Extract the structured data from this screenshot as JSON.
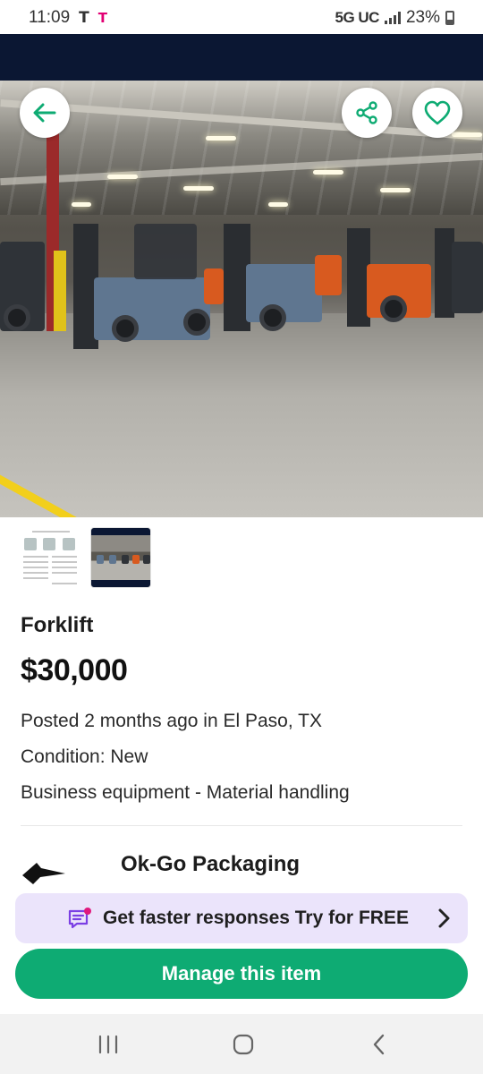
{
  "status_bar": {
    "time": "11:09",
    "carrier_icon_1": "T",
    "carrier_icon_2": "T",
    "network": "5G UC",
    "battery": "23%"
  },
  "header": {
    "back_icon": "arrow-left-icon",
    "share_icon": "share-icon",
    "favorite_icon": "heart-icon",
    "accent_color": "#0eab73"
  },
  "listing": {
    "title": "Forklift",
    "price": "$30,000",
    "posted": "Posted 2 months ago in El Paso, TX",
    "condition": "Condition: New",
    "category": "Business equipment - Material handling"
  },
  "seller": {
    "name": "Ok-Go Packaging"
  },
  "promo": {
    "text": "Get faster responses Try for FREE",
    "background": "#ebe4fb",
    "icon_color": "#7b3fe4",
    "dot_color": "#e0197d"
  },
  "actions": {
    "manage_label": "Manage this item"
  },
  "nav": {
    "recent_icon": "recent-apps-icon",
    "home_icon": "home-icon",
    "back_icon": "back-chevron-icon"
  }
}
